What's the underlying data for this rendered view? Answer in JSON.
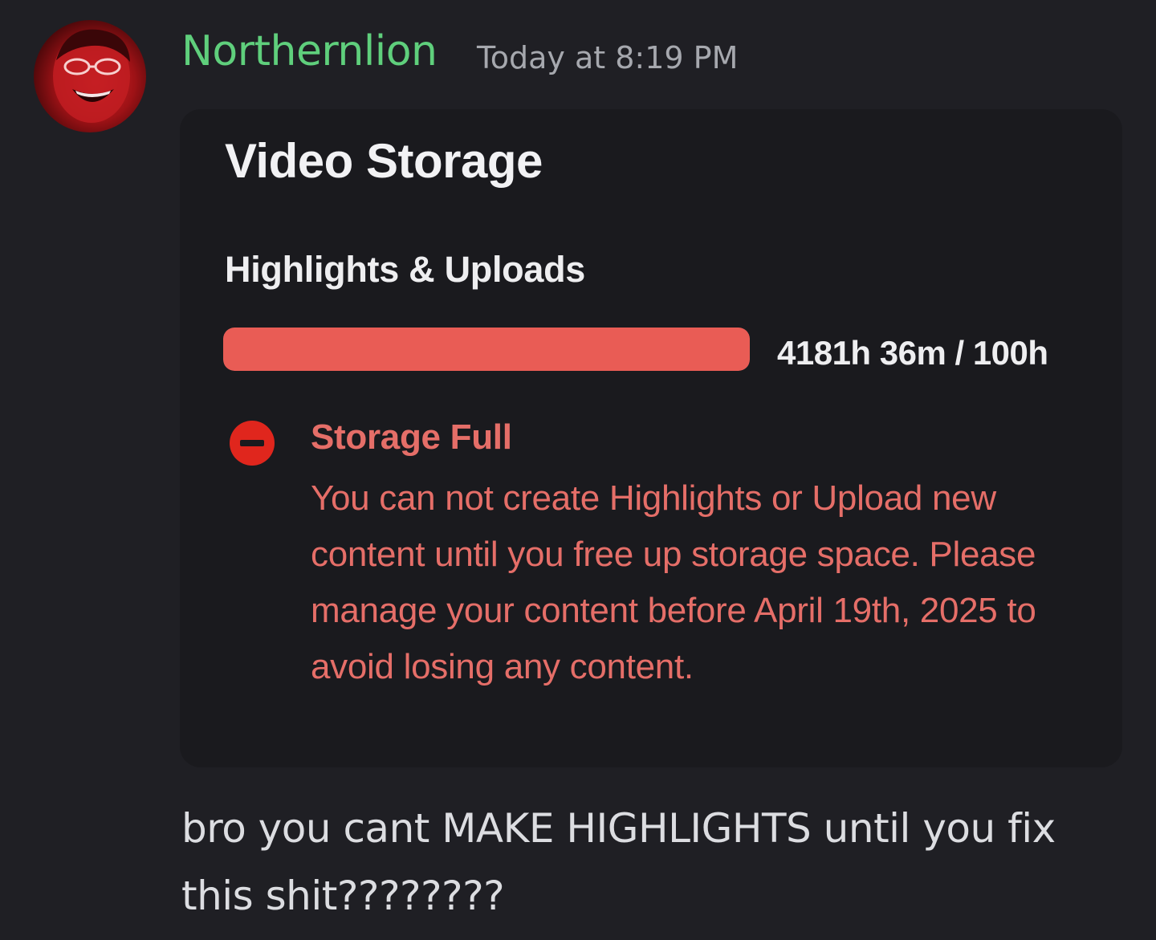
{
  "author": {
    "name": "Northernlion",
    "timestamp": "Today at 8:19 PM",
    "avatar_icon": "avatar-photo"
  },
  "embed": {
    "title": "Video Storage",
    "section": "Highlights & Uploads",
    "usage_text": "4181h 36m / 100h",
    "usage_fraction": 1.0,
    "bar_color": "#e95c55",
    "alert": {
      "icon": "minus-circle-icon",
      "title": "Storage Full",
      "body": "You can not create Highlights or Upload new content until you free up storage space. Please manage your content before April 19th, 2025 to avoid losing any content.",
      "color": "#e56e68"
    }
  },
  "message": {
    "text": "bro you cant MAKE HIGHLIGHTS until you fix this shit????????"
  },
  "colors": {
    "background": "#1f1f24",
    "username": "#5fcf7c",
    "timestamp": "#a6a8ae",
    "message_text": "#dcdde1"
  }
}
